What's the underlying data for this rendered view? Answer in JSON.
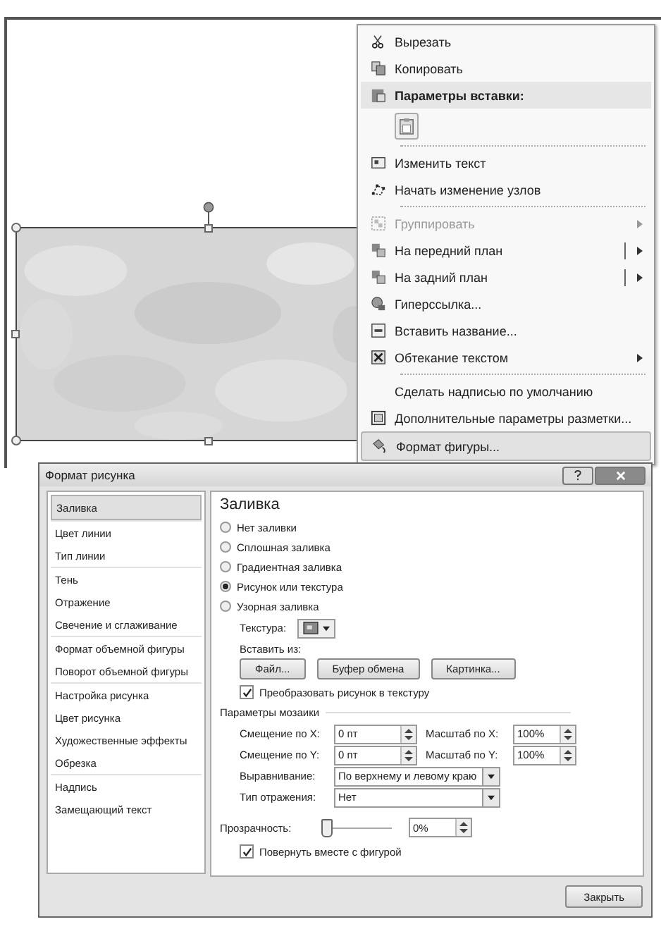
{
  "context_menu": {
    "items": [
      {
        "kind": "item",
        "label": "Вырезать",
        "disabled": false,
        "submenu": false,
        "split": false,
        "selected": false
      },
      {
        "kind": "item",
        "label": "Копировать",
        "disabled": false,
        "submenu": false,
        "split": false,
        "selected": false
      },
      {
        "kind": "header",
        "label": "Параметры вставки:"
      },
      {
        "kind": "paste-options"
      },
      {
        "kind": "separator"
      },
      {
        "kind": "item",
        "label": "Изменить текст",
        "disabled": false,
        "submenu": false,
        "split": false,
        "selected": false
      },
      {
        "kind": "item",
        "label": "Начать изменение узлов",
        "disabled": false,
        "submenu": false,
        "split": false,
        "selected": false
      },
      {
        "kind": "separator"
      },
      {
        "kind": "item",
        "label": "Группировать",
        "disabled": true,
        "submenu": true,
        "split": false,
        "selected": false
      },
      {
        "kind": "item",
        "label": "На передний план",
        "disabled": false,
        "submenu": true,
        "split": true,
        "selected": false
      },
      {
        "kind": "item",
        "label": "На задний план",
        "disabled": false,
        "submenu": true,
        "split": true,
        "selected": false
      },
      {
        "kind": "item",
        "label": "Гиперссылка...",
        "disabled": false,
        "submenu": false,
        "split": false,
        "selected": false
      },
      {
        "kind": "item",
        "label": "Вставить название...",
        "disabled": false,
        "submenu": false,
        "split": false,
        "selected": false
      },
      {
        "kind": "item",
        "label": "Обтекание текстом",
        "disabled": false,
        "submenu": true,
        "split": false,
        "selected": false
      },
      {
        "kind": "separator"
      },
      {
        "kind": "item",
        "label": "Сделать надписью по умолчанию",
        "disabled": false,
        "submenu": false,
        "split": false,
        "selected": false
      },
      {
        "kind": "item",
        "label": "Дополнительные параметры разметки...",
        "disabled": false,
        "submenu": false,
        "split": false,
        "selected": false
      },
      {
        "kind": "item",
        "label": "Формат фигуры...",
        "disabled": false,
        "submenu": false,
        "split": false,
        "selected": true
      }
    ]
  },
  "dialog": {
    "title": "Формат рисунка",
    "nav_groups": [
      [
        {
          "label": "Заливка",
          "selected": true
        }
      ],
      [
        {
          "label": "Цвет линии",
          "selected": false
        },
        {
          "label": "Тип линии",
          "selected": false
        }
      ],
      [
        {
          "label": "Тень",
          "selected": false
        },
        {
          "label": "Отражение",
          "selected": false
        },
        {
          "label": "Свечение и сглаживание",
          "selected": false
        }
      ],
      [
        {
          "label": "Формат объемной фигуры",
          "selected": false
        },
        {
          "label": "Поворот объемной фигуры",
          "selected": false
        }
      ],
      [
        {
          "label": "Настройка рисунка",
          "selected": false
        },
        {
          "label": "Цвет рисунка",
          "selected": false
        },
        {
          "label": "Художественные эффекты",
          "selected": false
        },
        {
          "label": "Обрезка",
          "selected": false
        }
      ],
      [
        {
          "label": "Надпись",
          "selected": false
        },
        {
          "label": "Замещающий текст",
          "selected": false
        }
      ]
    ],
    "heading": "Заливка",
    "fill_options": [
      {
        "label": "Нет заливки",
        "selected": false
      },
      {
        "label": "Сплошная заливка",
        "selected": false
      },
      {
        "label": "Градиентная заливка",
        "selected": false
      },
      {
        "label": "Рисунок или текстура",
        "selected": true
      },
      {
        "label": "Узорная заливка",
        "selected": false
      }
    ],
    "texture_label": "Текстура:",
    "insert_from_label": "Вставить из:",
    "insert_buttons": [
      "Файл...",
      "Буфер обмена",
      "Картинка..."
    ],
    "tile_checkbox": {
      "label": "Преобразовать рисунок в текстуру",
      "checked": true
    },
    "tiling_section": "Параметры мозаики",
    "offset_x": {
      "label": "Смещение по X:",
      "value": "0 пт"
    },
    "scale_x": {
      "label": "Масштаб по X:",
      "value": "100%"
    },
    "offset_y": {
      "label": "Смещение по Y:",
      "value": "0 пт"
    },
    "scale_y": {
      "label": "Масштаб по Y:",
      "value": "100%"
    },
    "alignment": {
      "label": "Выравнивание:",
      "value": "По верхнему и левому краю"
    },
    "mirror": {
      "label": "Тип отражения:",
      "value": "Нет"
    },
    "transparency": {
      "label": "Прозрачность:",
      "level": 0,
      "value": "0%"
    },
    "rotate_checkbox": {
      "label": "Повернуть вместе с фигурой",
      "checked": true
    },
    "close_button": "Закрыть"
  }
}
